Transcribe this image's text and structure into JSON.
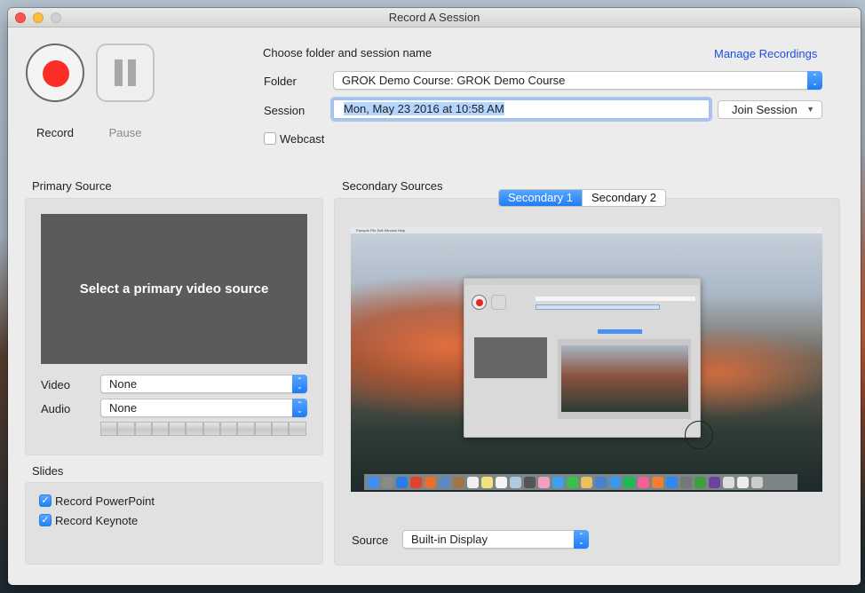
{
  "window": {
    "title": "Record A Session"
  },
  "controls": {
    "record_label": "Record",
    "pause_label": "Pause"
  },
  "session": {
    "heading": "Choose folder and session name",
    "manage_link": "Manage Recordings",
    "folder_label": "Folder",
    "folder_value": "GROK Demo Course: GROK Demo Course",
    "session_label": "Session",
    "session_value": "Mon, May 23 2016 at 10:58 AM",
    "join_label": "Join Session",
    "webcast_label": "Webcast",
    "webcast_checked": false
  },
  "primary": {
    "heading": "Primary Source",
    "placeholder": "Select a primary video source",
    "video_label": "Video",
    "video_value": "None",
    "audio_label": "Audio",
    "audio_value": "None",
    "audio_level_segments": 12,
    "audio_level": 0
  },
  "slides": {
    "heading": "Slides",
    "items": [
      {
        "label": "Record PowerPoint",
        "checked": true
      },
      {
        "label": "Record Keynote",
        "checked": true
      }
    ]
  },
  "secondary": {
    "heading": "Secondary Sources",
    "tabs": [
      {
        "label": "Secondary 1",
        "selected": true
      },
      {
        "label": "Secondary 2",
        "selected": false
      }
    ],
    "preview_menubar": "Panopto  File  Edit  Window  Help",
    "source_label": "Source",
    "source_value": "Built-in Display"
  },
  "colors": {
    "accent": "#1f7cf7",
    "record_red": "#fb2d26",
    "link_blue": "#1c4fe0"
  }
}
